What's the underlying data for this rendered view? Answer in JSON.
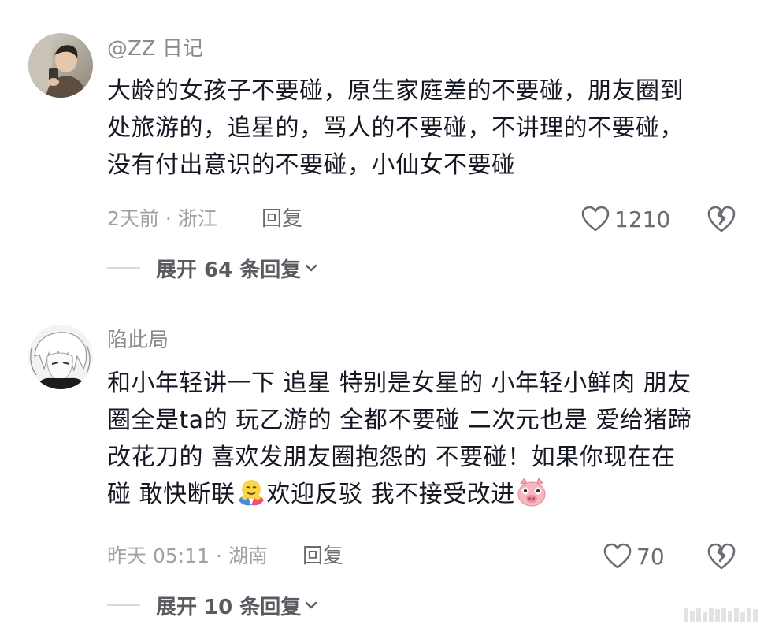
{
  "comments": [
    {
      "username": "@ZZ 日记",
      "lines": [
        "大龄的女孩子不要碰，原生家庭差的不要碰，朋友圈到",
        "处旅游的，追星的，骂人的不要碰，不讲理的不要碰，",
        "没有付出意识的不要碰，小仙女不要碰"
      ],
      "time_location": "2天前 · 浙江",
      "reply_label": "回复",
      "like_count": "1210",
      "expand_label": "展开 64 条回复"
    },
    {
      "username": "陷此局",
      "lines": [
        "和小年轻讲一下 追星 特别是女星的 小年轻小鲜肉 朋友",
        "圈全是ta的 玩乙游的 全都不要碰 二次元也是 爱给猪蹄",
        "改花刀的 喜欢发朋友圈抱怨的 不要碰！如果你现在在"
      ],
      "last_line_a": "碰 敢快断联",
      "last_line_b": "欢迎反驳 我不接受改进",
      "time_location": "昨天 05:11 · 湖南",
      "reply_label": "回复",
      "like_count": "70",
      "expand_label": "展开 10 条回复"
    }
  ],
  "icons": {
    "like": "heart-outline-icon",
    "dislike": "broken-heart-icon",
    "expand": "chevron-down-icon",
    "emoji_1": "hugging-face-emoji-icon",
    "emoji_2": "pig-face-emoji-icon"
  },
  "colors": {
    "text": "#161823",
    "muted": "#8a8b91",
    "meta": "#a0a1a7"
  }
}
